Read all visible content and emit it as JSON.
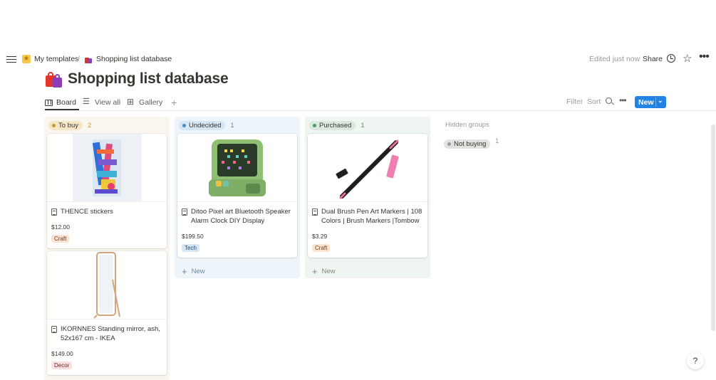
{
  "breadcrumb": {
    "parent": "My templates",
    "separator": "/",
    "current": "Shopping list database"
  },
  "topbar": {
    "edited": "Edited just now",
    "share": "Share"
  },
  "page": {
    "title": "Shopping list database"
  },
  "views": {
    "tabs": [
      {
        "label": "Board",
        "active": true
      },
      {
        "label": "View all",
        "active": false
      },
      {
        "label": "Gallery",
        "active": false
      }
    ],
    "add": "+",
    "filter": "Filter",
    "sort": "Sort",
    "new_button": "New"
  },
  "columns": [
    {
      "name": "To buy",
      "count": "2",
      "color": "#c99a32",
      "pill_bg": "#f6e7c9",
      "cards": [
        {
          "title": "THENCE stickers",
          "price": "$12.00",
          "tag": "Craft",
          "image": "sticker-pack-image"
        },
        {
          "title": "IKORNNES Standing mirror, ash, 52x167 cm - IKEA",
          "price": "$149.00",
          "tag": "Decor",
          "image": "mirror-image"
        }
      ]
    },
    {
      "name": "Undecided",
      "count": "1",
      "color": "#4f8ab8",
      "pill_bg": "#d5e7f4",
      "cards": [
        {
          "title": "Ditoo Pixel art Bluetooth Speaker Alarm Clock DIY Display",
          "price": "$199.50",
          "tag": "Tech",
          "image": "pixel-speaker-image"
        }
      ],
      "add_label": "New"
    },
    {
      "name": "Purchased",
      "count": "1",
      "color": "#4b9a63",
      "pill_bg": "#d9eadd",
      "cards": [
        {
          "title": "Dual Brush Pen Art Markers | 108 Colors | Brush Markers |Tombow",
          "price": "$3.29",
          "tag": "Craft",
          "image": "brush-pen-image"
        }
      ],
      "add_label": "New"
    }
  ],
  "hidden_groups": {
    "label": "Hidden groups",
    "items": [
      {
        "name": "Not buying",
        "count": "1"
      }
    ]
  },
  "help": "?"
}
